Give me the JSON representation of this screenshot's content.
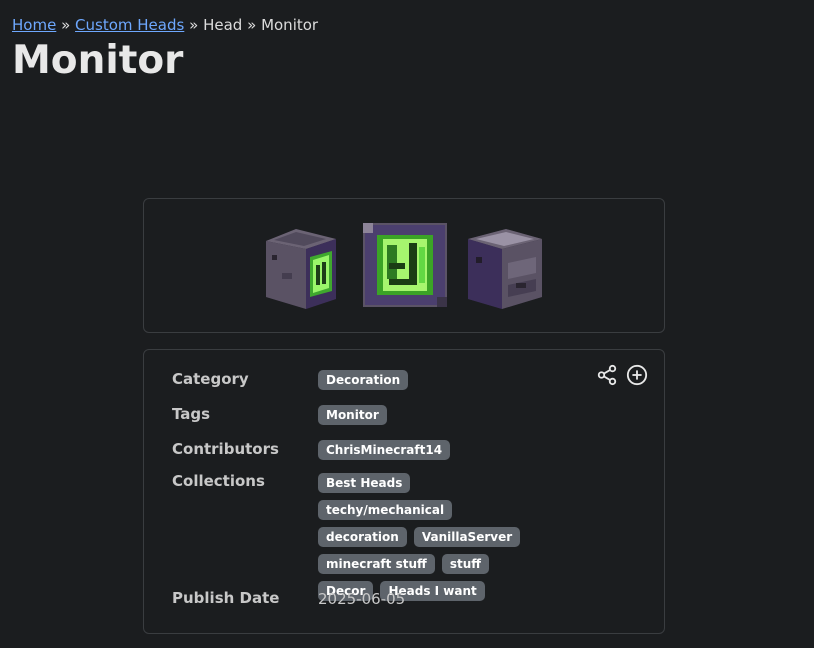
{
  "breadcrumb": {
    "home": "Home",
    "sep1": "»",
    "custom_heads": "Custom Heads",
    "sep2": "»",
    "head": "Head",
    "sep3": "»",
    "current": "Monitor"
  },
  "title": "Monitor",
  "details": {
    "category_label": "Category",
    "category": "Decoration",
    "tags_label": "Tags",
    "tags": [
      "Monitor"
    ],
    "contributors_label": "Contributors",
    "contributors": [
      "ChrisMinecraft14"
    ],
    "collections_label": "Collections",
    "collections": [
      "Best Heads",
      "techy/mechanical",
      "decoration",
      "VanillaServer",
      "minecraft stuff",
      "stuff",
      "Decor",
      "Heads I want"
    ],
    "publish_label": "Publish Date",
    "publish_date": "2025-06-05"
  },
  "icons": {
    "share": "share-icon",
    "add": "plus-circle-icon"
  },
  "colors": {
    "background": "#1b1d1f",
    "link": "#6ea8fe",
    "badge": "#5e646b",
    "border": "#3a3d40",
    "screen_green": "#6fe04a"
  }
}
